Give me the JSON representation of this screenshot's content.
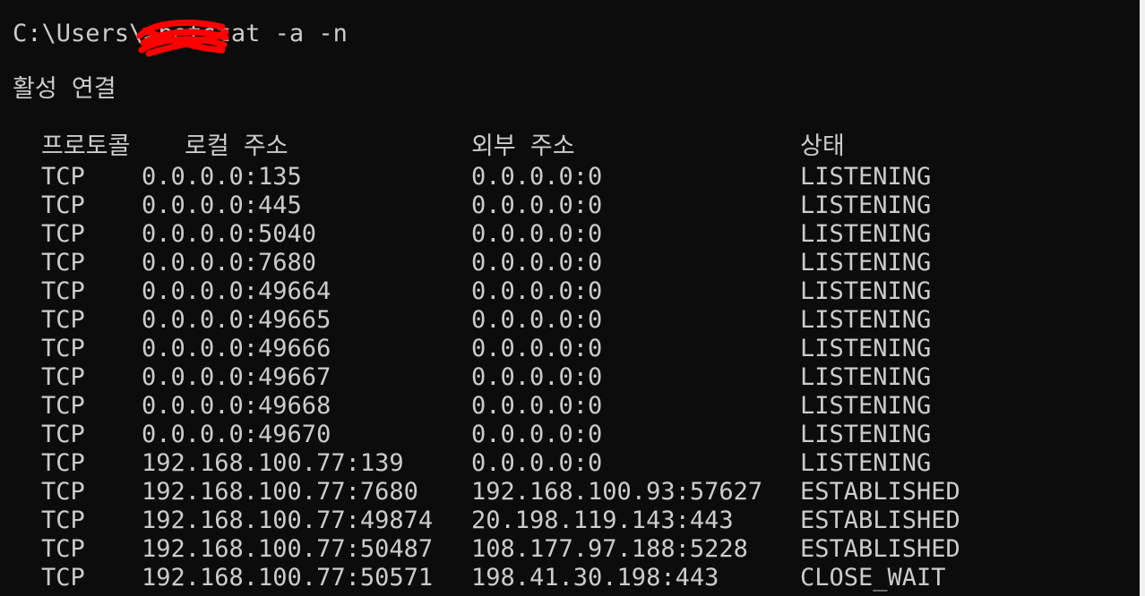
{
  "console": {
    "prompt_path": "C:\\Users\\",
    "redacted_user": "",
    "prompt_suffix": ">",
    "command": "netstat -a -n",
    "title": "활성 연결",
    "headers": {
      "proto": "프로토콜",
      "local": "로컬 주소",
      "foreign": "외부 주소",
      "state": "상태"
    },
    "rows": [
      {
        "proto": "TCP",
        "local": "0.0.0.0:135",
        "foreign": "0.0.0.0:0",
        "state": "LISTENING"
      },
      {
        "proto": "TCP",
        "local": "0.0.0.0:445",
        "foreign": "0.0.0.0:0",
        "state": "LISTENING"
      },
      {
        "proto": "TCP",
        "local": "0.0.0.0:5040",
        "foreign": "0.0.0.0:0",
        "state": "LISTENING"
      },
      {
        "proto": "TCP",
        "local": "0.0.0.0:7680",
        "foreign": "0.0.0.0:0",
        "state": "LISTENING"
      },
      {
        "proto": "TCP",
        "local": "0.0.0.0:49664",
        "foreign": "0.0.0.0:0",
        "state": "LISTENING"
      },
      {
        "proto": "TCP",
        "local": "0.0.0.0:49665",
        "foreign": "0.0.0.0:0",
        "state": "LISTENING"
      },
      {
        "proto": "TCP",
        "local": "0.0.0.0:49666",
        "foreign": "0.0.0.0:0",
        "state": "LISTENING"
      },
      {
        "proto": "TCP",
        "local": "0.0.0.0:49667",
        "foreign": "0.0.0.0:0",
        "state": "LISTENING"
      },
      {
        "proto": "TCP",
        "local": "0.0.0.0:49668",
        "foreign": "0.0.0.0:0",
        "state": "LISTENING"
      },
      {
        "proto": "TCP",
        "local": "0.0.0.0:49670",
        "foreign": "0.0.0.0:0",
        "state": "LISTENING"
      },
      {
        "proto": "TCP",
        "local": "192.168.100.77:139",
        "foreign": "0.0.0.0:0",
        "state": "LISTENING"
      },
      {
        "proto": "TCP",
        "local": "192.168.100.77:7680",
        "foreign": "192.168.100.93:57627",
        "state": "ESTABLISHED"
      },
      {
        "proto": "TCP",
        "local": "192.168.100.77:49874",
        "foreign": "20.198.119.143:443",
        "state": "ESTABLISHED"
      },
      {
        "proto": "TCP",
        "local": "192.168.100.77:50487",
        "foreign": "108.177.97.188:5228",
        "state": "ESTABLISHED"
      },
      {
        "proto": "TCP",
        "local": "192.168.100.77:50571",
        "foreign": "198.41.30.198:443",
        "state": "CLOSE_WAIT"
      }
    ],
    "colors": {
      "background": "#0c0c0c",
      "text": "#cccccc",
      "redaction": "#ff0000"
    }
  }
}
